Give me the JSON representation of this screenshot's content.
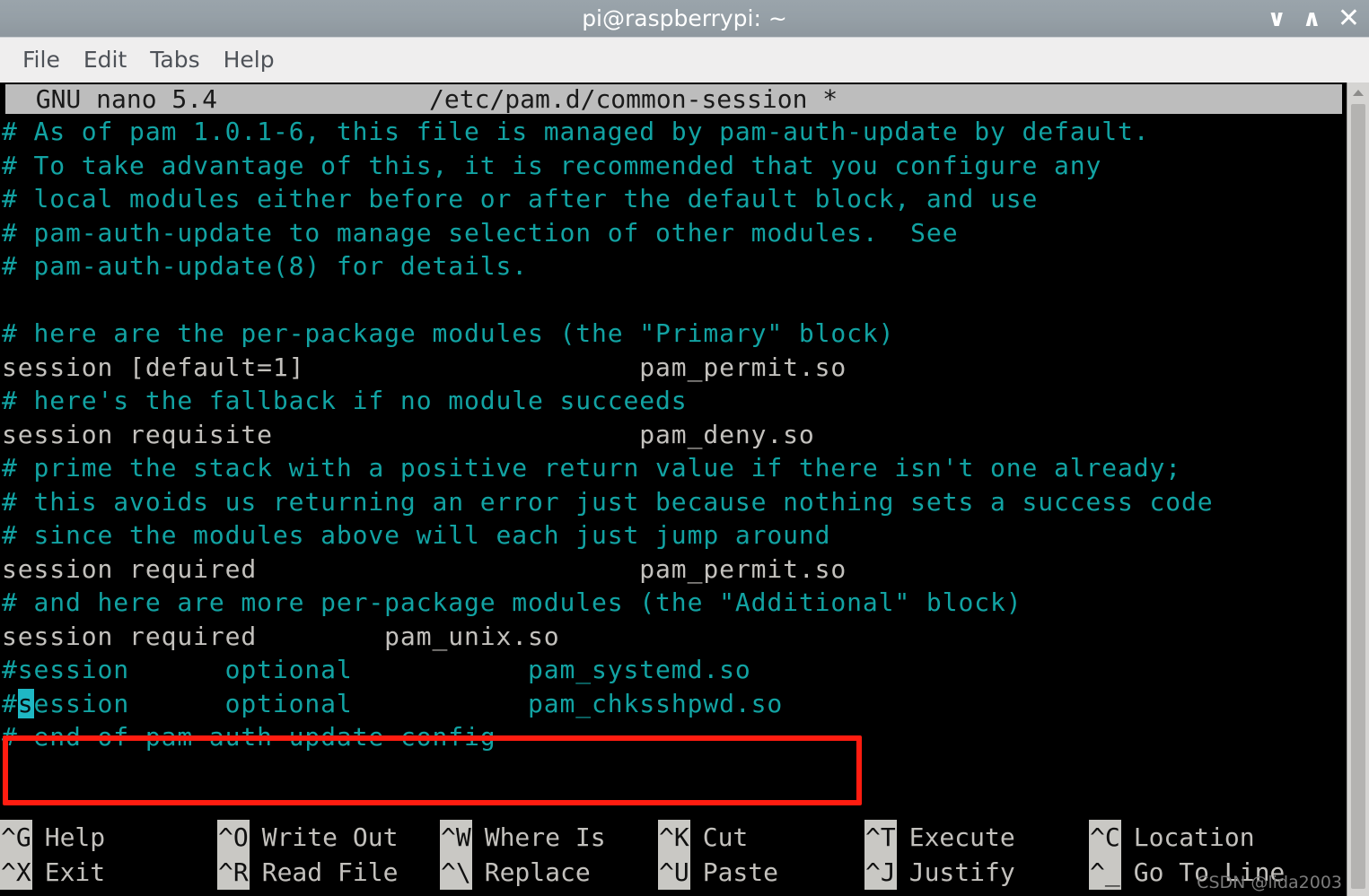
{
  "window": {
    "title": "pi@raspberrypi: ~",
    "controls": {
      "minimize": "∨",
      "maximize": "∧",
      "close": "✕"
    }
  },
  "menubar": {
    "items": [
      {
        "label": "File"
      },
      {
        "label": "Edit"
      },
      {
        "label": "Tabs"
      },
      {
        "label": "Help"
      }
    ]
  },
  "nano": {
    "header": "  GNU nano 5.4              /etc/pam.d/common-session *",
    "version_label": "GNU nano 5.4",
    "file_label": "/etc/pam.d/common-session *",
    "modified_flag": "*",
    "lines": [
      {
        "text": "# As of pam 1.0.1-6, this file is managed by pam-auth-update by default.",
        "kind": "comment"
      },
      {
        "text": "# To take advantage of this, it is recommended that you configure any",
        "kind": "comment"
      },
      {
        "text": "# local modules either before or after the default block, and use",
        "kind": "comment"
      },
      {
        "text": "# pam-auth-update to manage selection of other modules.  See",
        "kind": "comment"
      },
      {
        "text": "# pam-auth-update(8) for details.",
        "kind": "comment"
      },
      {
        "text": "",
        "kind": "blank"
      },
      {
        "text": "# here are the per-package modules (the \"Primary\" block)",
        "kind": "comment"
      },
      {
        "text": "session [default=1]                     pam_permit.so",
        "kind": "code"
      },
      {
        "text": "# here's the fallback if no module succeeds",
        "kind": "comment"
      },
      {
        "text": "session requisite                       pam_deny.so",
        "kind": "code"
      },
      {
        "text": "# prime the stack with a positive return value if there isn't one already;",
        "kind": "comment"
      },
      {
        "text": "# this avoids us returning an error just because nothing sets a success code",
        "kind": "comment"
      },
      {
        "text": "# since the modules above will each just jump around",
        "kind": "comment"
      },
      {
        "text": "session required                        pam_permit.so",
        "kind": "code"
      },
      {
        "text": "# and here are more per-package modules (the \"Additional\" block)",
        "kind": "comment"
      },
      {
        "text": "session required        pam_unix.so",
        "kind": "code"
      },
      {
        "text": "#session      optional           pam_systemd.so",
        "kind": "comment"
      },
      {
        "text": "#session      optional           pam_chksshpwd.so",
        "kind": "comment",
        "cursor_index": 1
      },
      {
        "text": "# end of pam-auth-update config",
        "kind": "comment"
      }
    ],
    "shortcuts_row1": [
      {
        "key": "^G",
        "label": "Help"
      },
      {
        "key": "^O",
        "label": "Write Out"
      },
      {
        "key": "^W",
        "label": "Where Is"
      },
      {
        "key": "^K",
        "label": "Cut"
      },
      {
        "key": "^T",
        "label": "Execute"
      },
      {
        "key": "^C",
        "label": "Location"
      }
    ],
    "shortcuts_row2": [
      {
        "key": "^X",
        "label": "Exit"
      },
      {
        "key": "^R",
        "label": "Read File"
      },
      {
        "key": "^\\",
        "label": "Replace"
      },
      {
        "key": "^U",
        "label": "Paste"
      },
      {
        "key": "^J",
        "label": "Justify"
      },
      {
        "key": "^_",
        "label": "Go To Line"
      }
    ]
  },
  "annotation": {
    "highlight_color": "#ff1c10",
    "highlighted_lines": [
      "#session      optional           pam_systemd.so",
      "#session      optional           pam_chksshpwd.so"
    ]
  },
  "watermark": {
    "text": "CSDN @lida2003"
  },
  "colors": {
    "terminal_background": "#000000",
    "comment_text": "#12a3a3",
    "code_text": "#c3c1bd",
    "cursor": "#1fb8c4",
    "titlebar": "#96a0a7",
    "menubar": "#efeeee"
  }
}
